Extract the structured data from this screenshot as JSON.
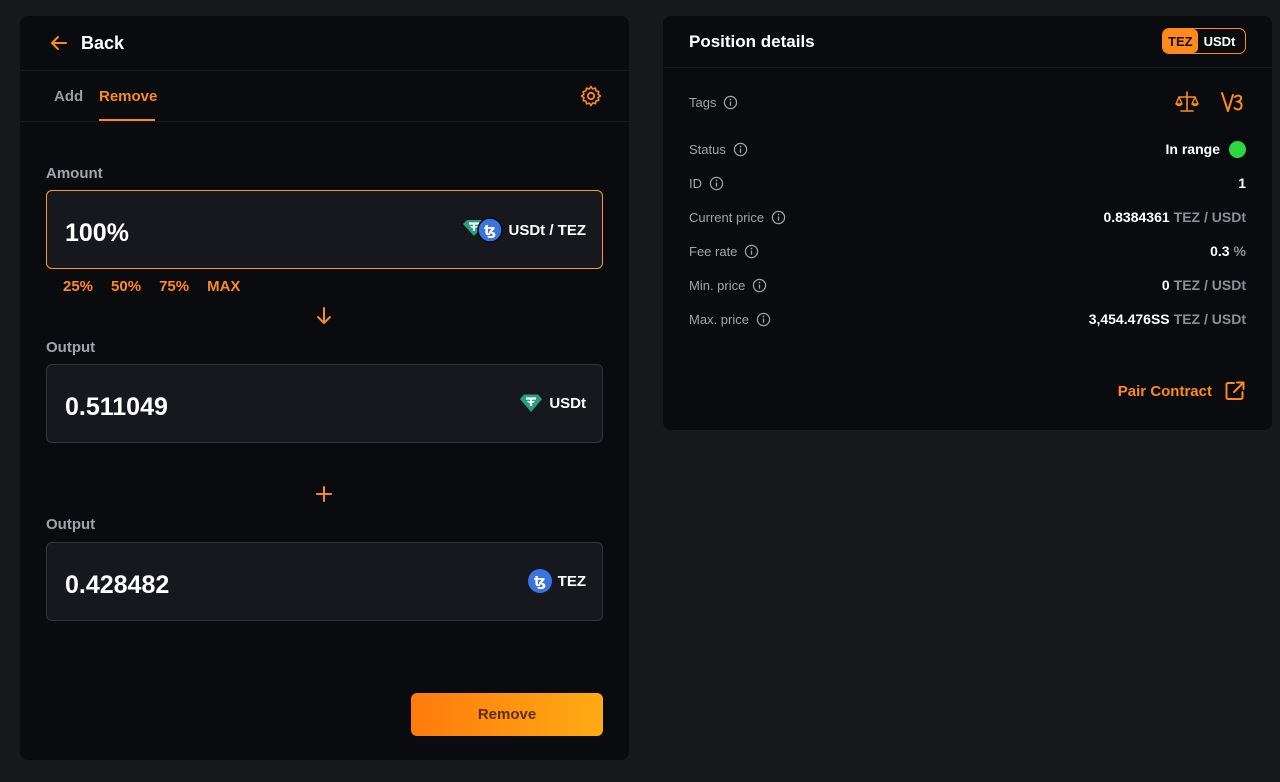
{
  "left": {
    "back_label": "Back",
    "tabs": [
      {
        "label": "Add",
        "active": false
      },
      {
        "label": "Remove",
        "active": true
      }
    ],
    "amount": {
      "label": "Amount",
      "value": "100%",
      "token_label": "USDt / TEZ"
    },
    "quick_options": [
      "25%",
      "50%",
      "75%",
      "MAX"
    ],
    "output1": {
      "label": "Output",
      "value": "0.511049",
      "token_label": "USDt"
    },
    "output2": {
      "label": "Output",
      "value": "0.428482",
      "token_label": "TEZ"
    },
    "remove_button": "Remove"
  },
  "right": {
    "title": "Position details",
    "pair": {
      "a": "TEZ",
      "b": "USDt"
    },
    "rows": {
      "tags": {
        "label": "Tags"
      },
      "status": {
        "label": "Status",
        "value": "In range"
      },
      "id": {
        "label": "ID",
        "value": "1"
      },
      "current_price": {
        "label": "Current price",
        "value": "0.8384361",
        "unit": "TEZ / USDt"
      },
      "fee_rate": {
        "label": "Fee rate",
        "value": "0.3",
        "unit": "%"
      },
      "min_price": {
        "label": "Min. price",
        "value": "0",
        "unit": "TEZ / USDt"
      },
      "max_price": {
        "label": "Max. price",
        "value": "3,454.476SS",
        "unit": "TEZ / USDt"
      }
    },
    "pair_contract": "Pair Contract"
  },
  "colors": {
    "accent": "#ff8a1c",
    "background": "#17181c",
    "panel": "#0a0b0e",
    "status_ok": "#2bd83f",
    "tezos_blue": "#3b73e0",
    "tether_teal": "#26a17b"
  },
  "icons": {
    "back": "arrow-left-icon",
    "settings": "gear-icon",
    "down": "arrow-down-icon",
    "plus": "plus-icon",
    "info": "info-icon",
    "scales": "scales-icon",
    "v3": "v3-icon",
    "external": "external-link-icon"
  }
}
